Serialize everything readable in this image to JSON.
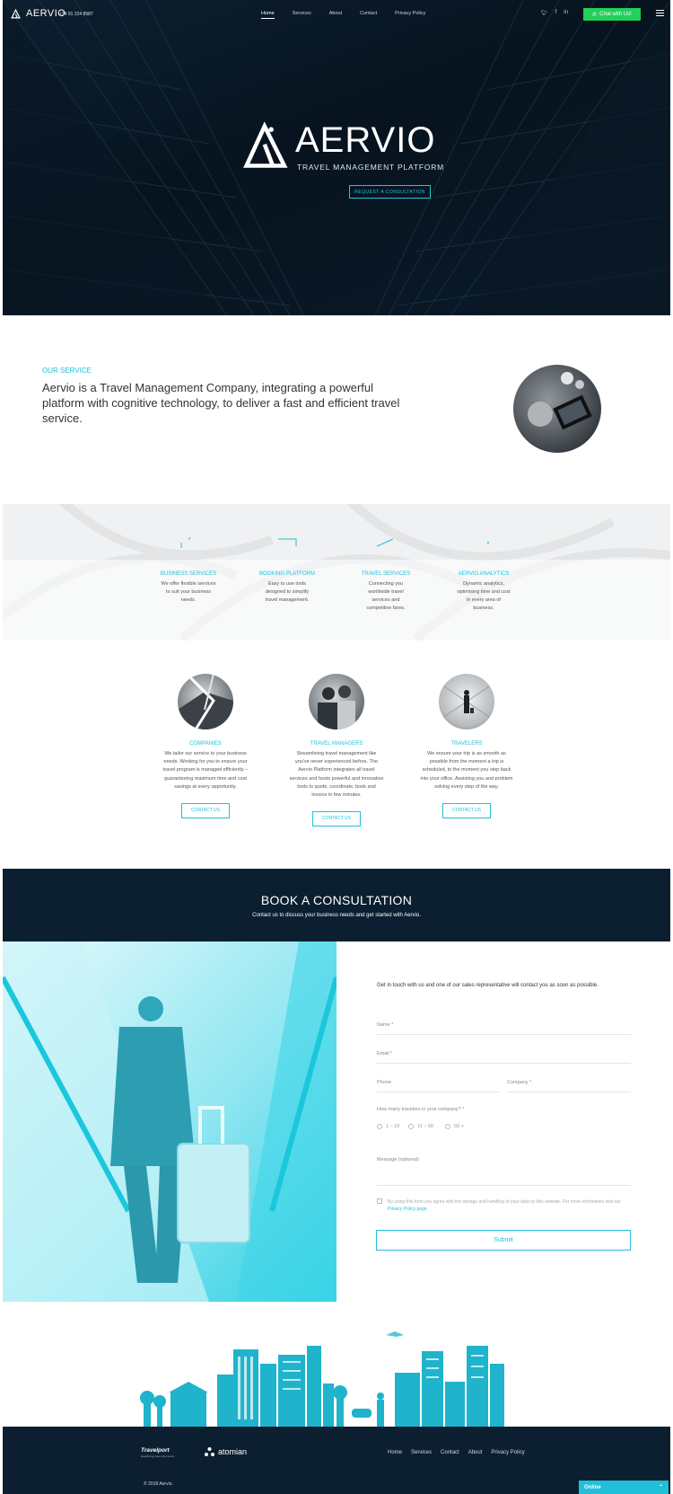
{
  "header": {
    "brand": "AERVIO",
    "phone": "+34 91 224 8587",
    "nav": [
      "Home",
      "Services",
      "About",
      "Contact",
      "Privacy Policy"
    ],
    "social": [
      "twitter-icon",
      "facebook-icon",
      "linkedin-icon"
    ],
    "chat_label": "Chat with Us!",
    "accent": "#22bfd8",
    "chat_color": "#22d05a"
  },
  "hero": {
    "title": "AERVIO",
    "subtitle": "TRAVEL MANAGEMENT PLATFORM",
    "cta": "REQUEST A CONSULTATION"
  },
  "service": {
    "heading": "OUR SERVICE",
    "text": "Aervio is a Travel Management Company, integrating a powerful platform with cognitive technology, to deliver a fast and efficient travel service."
  },
  "features": [
    {
      "title": "BUSINESS SERVICES",
      "desc": "We offer flexible services to suit your business needs."
    },
    {
      "title": "BOOKING PLATFORM",
      "desc": "Easy to use tools designed to simplify travel management."
    },
    {
      "title": "TRAVEL SERVICES",
      "desc": "Connecting you worldwide travel services and competitive fares."
    },
    {
      "title": "AERVIO ANALYTICS",
      "desc": "Dynamic analytics, optimising time and cost in every area of business."
    }
  ],
  "audiences": [
    {
      "title": "COMPANIES",
      "desc": "We tailor our service to your business needs. Working for you to ensure your travel program is managed efficiently – guaranteeing maximum time and cost savings at every opportunity.",
      "button": "CONTACT US"
    },
    {
      "title": "TRAVEL MANAGERS",
      "desc": "Streamlining travel management like you've never experienced before. The Aervio Platform integrates all travel services and hosts powerful and innovative tools to quote, coordinate, book and invoice in few minutes.",
      "button": "CONTACT US"
    },
    {
      "title": "TRAVELERS",
      "desc": "We ensure your trip is as smooth as possible from the moment a trip is scheduled, to the moment you step back into your office. Assisting you and problem solving every step of the way.",
      "button": "CONTACT US"
    }
  ],
  "book": {
    "title": "BOOK A CONSULTATION",
    "subtitle": "Contact us to discuss your business needs and get started with Aervio."
  },
  "form": {
    "intro": "Get in touch with us and one of our sales representative will contact you as soon as possible.",
    "name_label": "Name",
    "email_label": "Email",
    "phone_label": "Phone",
    "company_label": "Company",
    "travelers_label": "How many travelers in your company?",
    "required_mark": "*",
    "options": [
      "1 – 10",
      "11 – 50",
      "50 +"
    ],
    "message_label": "Message (optional)",
    "consent_text": "By using this form you agree with the storage and handling of your data by this website. For more information visit our",
    "consent_link": "Privacy Policy page",
    "submit": "Submit"
  },
  "footer": {
    "partner1": "Travelport",
    "partner1_tag": "Redefining travel commerce",
    "partner2": "atomian",
    "nav": [
      "Home",
      "Services",
      "Contact",
      "About",
      "Privacy Policy"
    ],
    "copyright": "© 2018 Aervio.",
    "online_label": "Online"
  }
}
